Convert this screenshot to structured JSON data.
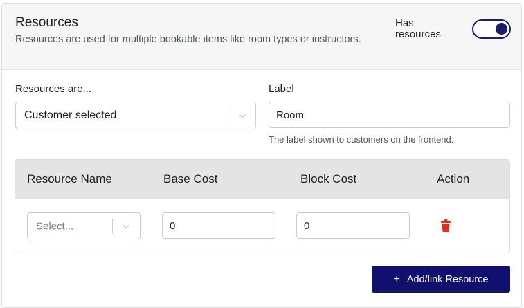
{
  "header": {
    "title": "Resources",
    "description": "Resources are used for multiple bookable items like room types or instructors.",
    "toggle_label": "Has resources",
    "toggle_on": true
  },
  "resources_are": {
    "label": "Resources are...",
    "selected": "Customer selected"
  },
  "label_field": {
    "label": "Label",
    "value": "Room",
    "help": "The label shown to customers on the frontend."
  },
  "table": {
    "columns": [
      "Resource Name",
      "Base Cost",
      "Block Cost",
      "Action"
    ],
    "rows": [
      {
        "resource_placeholder": "Select...",
        "base_cost": "0",
        "block_cost": "0",
        "action_icon": "trash-icon"
      }
    ]
  },
  "add_button": {
    "icon": "plus-icon",
    "label": "Add/link Resource"
  },
  "colors": {
    "primary": "#10116e",
    "toggle": "#1a1d6b",
    "danger": "#e42f1c",
    "header_bg": "#f6f6f6",
    "table_head_bg": "#e4e4e4"
  }
}
